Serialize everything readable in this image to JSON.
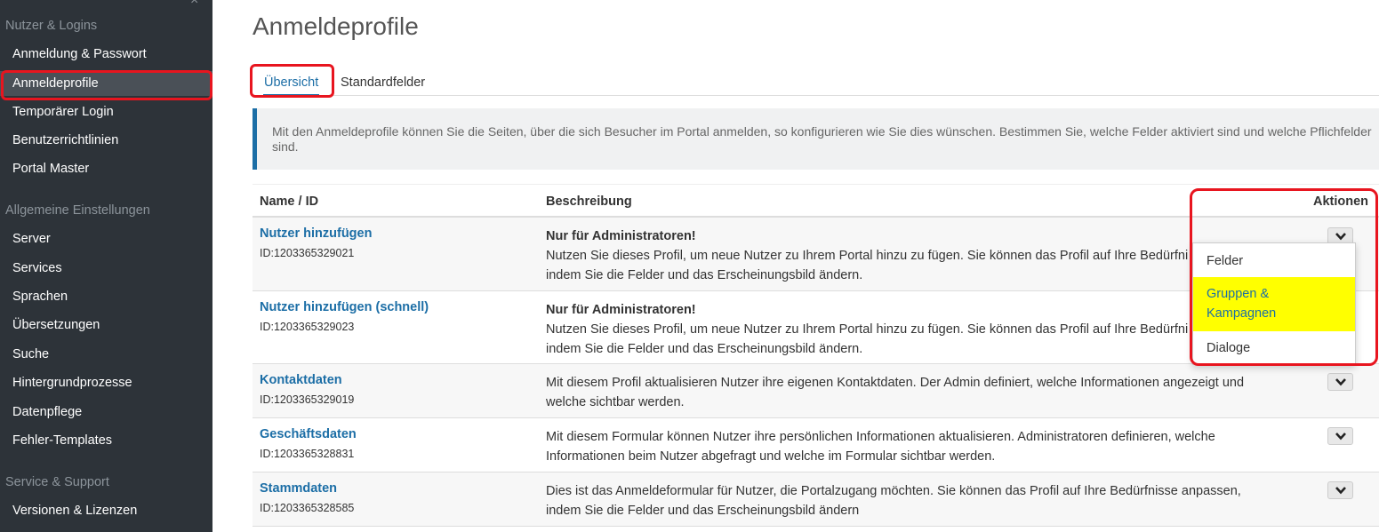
{
  "sidebar": {
    "sections": [
      {
        "title": "Nutzer & Logins"
      },
      {
        "title": "Allgemeine Einstellungen"
      },
      {
        "title": "Service & Support"
      }
    ],
    "items": [
      {
        "label": "Anmeldung & Passwort"
      },
      {
        "label": "Anmeldeprofile"
      },
      {
        "label": "Temporärer Login"
      },
      {
        "label": "Benutzerrichtlinien"
      },
      {
        "label": "Portal Master"
      },
      {
        "label": "Server"
      },
      {
        "label": "Services"
      },
      {
        "label": "Sprachen"
      },
      {
        "label": "Übersetzungen"
      },
      {
        "label": "Suche"
      },
      {
        "label": "Hintergrundprozesse"
      },
      {
        "label": "Datenpflege"
      },
      {
        "label": "Fehler-Templates"
      },
      {
        "label": "Versionen & Lizenzen"
      }
    ],
    "close_glyph": "×"
  },
  "page": {
    "title": "Anmeldeprofile",
    "tabs": [
      {
        "label": "Übersicht",
        "active": true
      },
      {
        "label": "Standardfelder",
        "active": false
      }
    ],
    "info": "Mit den Anmeldeprofile können Sie die Seiten, über die sich Besucher im Portal anmelden, so konfigurieren wie Sie dies wünschen. Bestimmen Sie, welche Felder aktiviert sind und welche Pflichfelder sind."
  },
  "table": {
    "headers": {
      "name": "Name / ID",
      "description": "Beschreibung",
      "actions": "Aktionen"
    },
    "rows": [
      {
        "name": "Nutzer hinzufügen",
        "id": "ID:1203365329021",
        "desc_bold": "Nur für Administratoren!",
        "desc": "Nutzen Sie dieses Profil, um neue Nutzer zu Ihrem Portal hinzu zu fügen. Sie können das Profil auf Ihre Bedürfni",
        "desc2": "indem Sie die Felder und das Erscheinungsbild ändern."
      },
      {
        "name": "Nutzer hinzufügen (schnell)",
        "id": "ID:1203365329023",
        "desc_bold": "Nur für Administratoren!",
        "desc": "Nutzen Sie dieses Profil, um neue Nutzer zu Ihrem Portal hinzu zu fügen. Sie können das Profil auf Ihre Bedürfni",
        "desc2": "indem Sie die Felder und das Erscheinungsbild ändern."
      },
      {
        "name": "Kontaktdaten",
        "id": "ID:1203365329019",
        "desc": "Mit diesem Profil aktualisieren Nutzer ihre eigenen Kontaktdaten. Der Admin definiert, welche Informationen angezeigt und",
        "desc2": "welche sichtbar werden."
      },
      {
        "name": "Geschäftsdaten",
        "id": "ID:1203365328831",
        "desc": "Mit diesem Formular können Nutzer ihre persönlichen Informationen aktualisieren. Administratoren definieren, welche",
        "desc2": "Informationen beim Nutzer abgefragt und welche im Formular sichtbar werden."
      },
      {
        "name": "Stammdaten",
        "id": "ID:1203365328585",
        "desc": "Dies ist das Anmeldeformular für Nutzer, die Portalzugang möchten. Sie können das Profil auf Ihre Bedürfnisse anpassen,",
        "desc2": "indem Sie die Felder und das Erscheinungsbild ändern"
      }
    ]
  },
  "menu": {
    "items": [
      {
        "label": "Felder"
      },
      {
        "label": "Gruppen &"
      },
      {
        "label": "Kampagnen"
      },
      {
        "label": "Dialoge"
      }
    ]
  },
  "colors": {
    "highlight": "#e8151f",
    "link": "#1c6ea6",
    "menu_highlight": "#ffff00",
    "sidebar": "#2d3339"
  }
}
